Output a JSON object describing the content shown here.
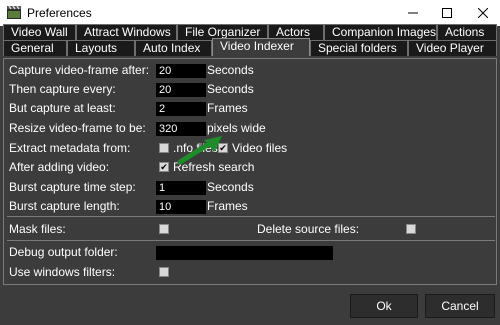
{
  "window": {
    "title": "Preferences",
    "minimize_icon": "minimize-icon",
    "maximize_icon": "maximize-icon",
    "close_icon": "close-icon"
  },
  "tabs": {
    "row1": [
      "Video Wall",
      "Attract Windows",
      "File Organizer",
      "Actors",
      "Companion Images",
      "Actions"
    ],
    "row2": [
      "General",
      "Layouts",
      "Auto Index",
      "Video Indexer",
      "Special folders",
      "Video Player"
    ],
    "active": "Video Indexer"
  },
  "form": {
    "capture_after": {
      "label": "Capture video-frame after:",
      "value": "20",
      "unit": "Seconds"
    },
    "capture_every": {
      "label": "Then capture every:",
      "value": "20",
      "unit": "Seconds"
    },
    "capture_least": {
      "label": "But capture at least:",
      "value": "2",
      "unit": "Frames"
    },
    "resize": {
      "label": "Resize video-frame to be:",
      "value": "320",
      "unit": "pixels wide"
    },
    "extract": {
      "label": "Extract metadata from:",
      "nfo_label": ".nfo files",
      "nfo_checked": false,
      "video_label": "Video files",
      "video_checked": true
    },
    "after_adding": {
      "label": "After adding video:",
      "refresh_label": "Refresh search",
      "refresh_checked": true
    },
    "burst_step": {
      "label": "Burst capture time step:",
      "value": "1",
      "unit": "Seconds"
    },
    "burst_length": {
      "label": "Burst capture length:",
      "value": "10",
      "unit": "Frames"
    },
    "mask": {
      "label": "Mask files:",
      "checked": false
    },
    "delete_source": {
      "label": "Delete source files:",
      "checked": false
    },
    "debug_folder": {
      "label": "Debug output folder:",
      "value": ""
    },
    "windows_filters": {
      "label": "Use windows filters:",
      "checked": false
    }
  },
  "buttons": {
    "ok": "Ok",
    "cancel": "Cancel"
  },
  "colors": {
    "background": "#3c3c3c",
    "tab_inactive": "#1a1a1a",
    "field": "#000000",
    "arrow": "#1e8c2a"
  }
}
